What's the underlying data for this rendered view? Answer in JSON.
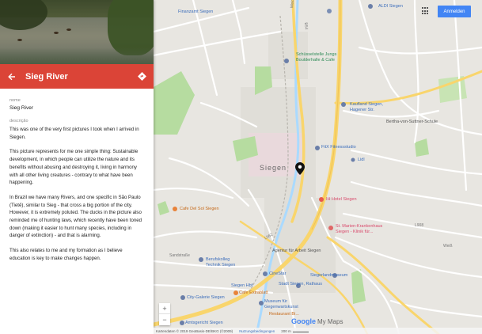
{
  "header": {
    "title": "Sieg River"
  },
  "fields": {
    "name_label": "nome",
    "name_value": "Sieg River",
    "desc_label": "descrição",
    "description": [
      "This was one of the very first pictures I took when I arrived in Siegen.",
      "This picture represents for me one simple thing: Sustainable development, in which people can utilize the nature and its benefits without abusing and destroying it, living in harmony with all other living creatures - contrary to what have been happening.",
      "In Brazil we have many Rivers, and one specific in São Paulo (Tietê), similar to Sieg - that cross a big portion of the city. However, it is extremely poluted. The ducks in the picture also reminded me of hunting laws, which recently have been toned down (making it easier to hunt many species, including in danger of extinction) - and that is alarming.",
      "This also relates to me and my formation as I believe education is key to make changes happen."
    ]
  },
  "map": {
    "login_label": "Anmelden",
    "zoom_in": "+",
    "zoom_out": "−",
    "logo_google": "Google",
    "logo_mymaps": "My Maps",
    "footer_data": "Kartendaten © 2019 GeoBasis-DE/BKG (©2009)",
    "footer_terms": "Nutzungsbedingungen",
    "footer_scale": "200 m",
    "labels": {
      "finanzamt": "Finanzamt Siegen",
      "aldi": "ALDI Siegen",
      "schuessel": "Schüsselstelle Jungs Boulderhalle & Cafe",
      "kaufland": "Kaufland Siegen, Hagener Str.",
      "bertha": "Bertha-von-Suttner-Schule",
      "fitx": "FitX Fitnessstudio",
      "siegen": "Siegen",
      "lidl": "Lidl",
      "cafe_del_sol": "Cafe Del Sol Siegen",
      "ih_hotel": "IH Hotel Siegen",
      "marien": "St. Marien-Krankenhaus Siegen - Klinik für...",
      "berufskolleg": "Berufskolleg Technik Siegen",
      "cinestar": "CineStar",
      "agentur": "Agentur für Arbeit Siegen",
      "siegen_hbf": "Siegen Hbf",
      "siegerlandmuseum": "Siegerlandmuseum",
      "city_galerie": "City-Galerie Siegen",
      "cafe_extrablatt": "Cafe Extrablatt",
      "rathaus": "Stadt Siegen, Rathaus",
      "museum": "Museum für Gegenwartskunst",
      "restaurant": "Restaurant Bi...",
      "amtsgericht": "Amtsgericht Siegen",
      "sandstr": "Sandstraße",
      "roads": [
        "Weidenauer Str.",
        "L562",
        "L908",
        "B54",
        "Weiß"
      ]
    }
  },
  "colors": {
    "accent_red": "#db4437",
    "login_blue": "#4285f4",
    "road_yellow": "#f9d56c",
    "park_green": "#b6dca0",
    "map_bg": "#e8e6e1"
  },
  "icons": {
    "back": "arrow-left-icon",
    "directions": "directions-icon",
    "apps": "apps-grid-icon",
    "pin": "map-pin-icon"
  }
}
